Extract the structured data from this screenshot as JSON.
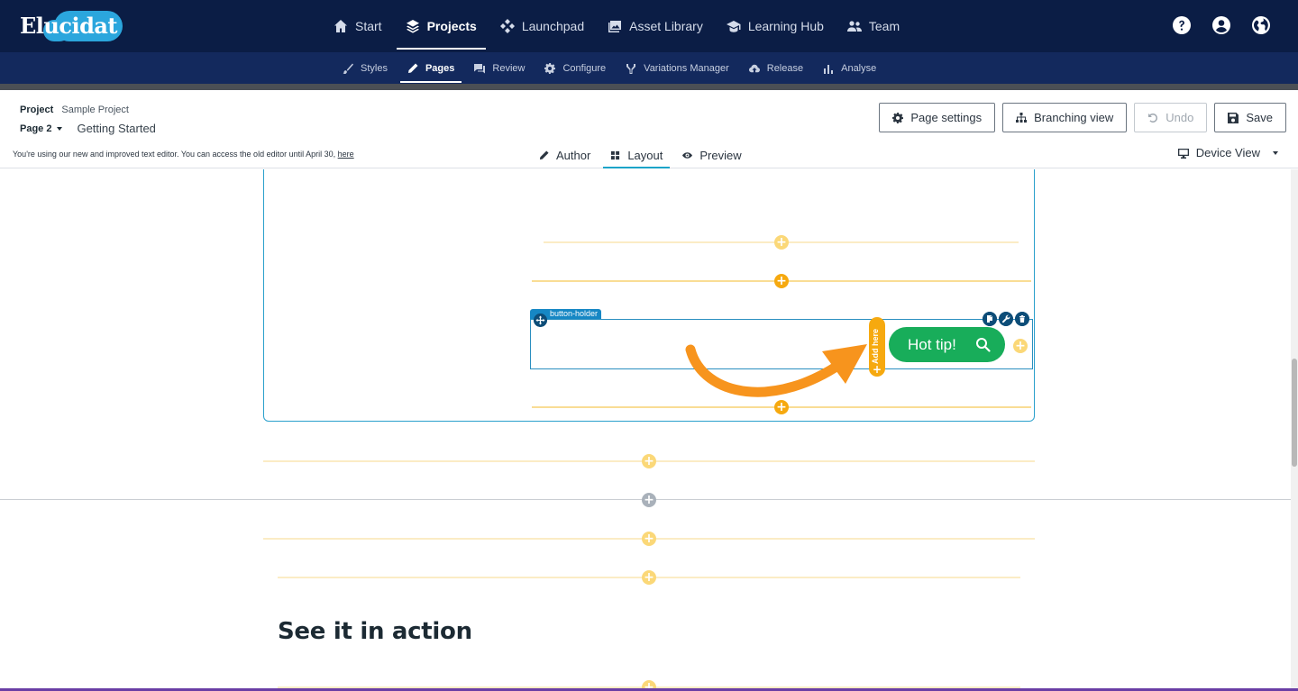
{
  "app": {
    "logo_text": "Elucidat"
  },
  "main_nav": {
    "items": [
      {
        "label": "Start",
        "icon": "home-icon"
      },
      {
        "label": "Projects",
        "icon": "layers-icon"
      },
      {
        "label": "Launchpad",
        "icon": "diamond-grid-icon"
      },
      {
        "label": "Asset Library",
        "icon": "image-library-icon"
      },
      {
        "label": "Learning Hub",
        "icon": "graduation-cap-icon"
      },
      {
        "label": "Team",
        "icon": "team-icon"
      }
    ],
    "active": "Projects"
  },
  "top_icons": [
    "help-icon",
    "user-icon",
    "globe-icon"
  ],
  "sub_nav": {
    "items": [
      {
        "label": "Styles",
        "icon": "brush-icon"
      },
      {
        "label": "Pages",
        "icon": "pencil-icon"
      },
      {
        "label": "Review",
        "icon": "comment-icon"
      },
      {
        "label": "Configure",
        "icon": "gear-icon"
      },
      {
        "label": "Variations Manager",
        "icon": "branch-icon"
      },
      {
        "label": "Release",
        "icon": "cloud-upload-icon"
      },
      {
        "label": "Analyse",
        "icon": "bar-chart-icon"
      }
    ],
    "active": "Pages"
  },
  "header": {
    "project_label": "Project",
    "project_name": "Sample Project",
    "page_number": "Page 2",
    "page_title": "Getting Started",
    "notice_text": "You're using our new and improved text editor. You can access the old editor until April 30,",
    "notice_link": "here",
    "buttons": {
      "page_settings": "Page settings",
      "branching_view": "Branching view",
      "undo": "Undo",
      "save": "Save"
    },
    "mode_tabs": [
      {
        "label": "Author",
        "icon": "pencil-icon"
      },
      {
        "label": "Layout",
        "icon": "grid-icon"
      },
      {
        "label": "Preview",
        "icon": "eye-icon"
      }
    ],
    "active_mode": "Layout",
    "device_view": "Device View"
  },
  "canvas": {
    "holder_tag": "button-holder",
    "add_here": "Add here",
    "hot_tip_button": "Hot tip!",
    "section_heading": "See it in action"
  },
  "colors": {
    "topbar": "#0b1d45",
    "subbar": "#13295d",
    "accent_blue": "#1aa4c9",
    "add_orange": "#f6a90f",
    "hot_tip_green": "#18ad5a",
    "arrow_orange": "#f7941d"
  }
}
